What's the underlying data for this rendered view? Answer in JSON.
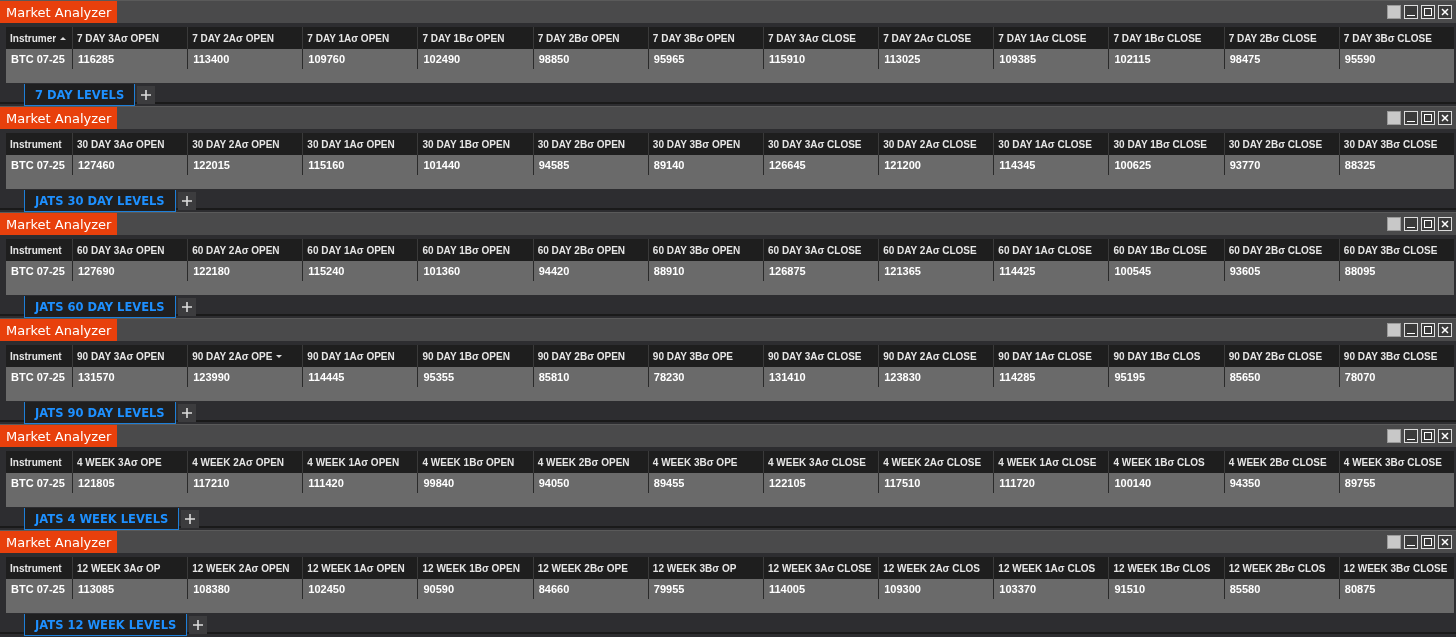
{
  "panels": [
    {
      "title": "Market Analyzer",
      "columns": [
        {
          "label": "Instrumer",
          "sort_ascending": true,
          "sort_descending": false
        },
        {
          "label": "7 DAY 3Aσ OPEN",
          "sort_ascending": false,
          "sort_descending": false
        },
        {
          "label": "7 DAY 2Aσ OPEN",
          "sort_ascending": false,
          "sort_descending": false
        },
        {
          "label": "7 DAY 1Aσ OPEN",
          "sort_ascending": false,
          "sort_descending": false
        },
        {
          "label": "7 DAY 1Bσ OPEN",
          "sort_ascending": false,
          "sort_descending": false
        },
        {
          "label": "7 DAY 2Bσ OPEN",
          "sort_ascending": false,
          "sort_descending": false
        },
        {
          "label": "7 DAY 3Bσ OPEN",
          "sort_ascending": false,
          "sort_descending": false
        },
        {
          "label": "7 DAY 3Aσ CLOSE",
          "sort_ascending": false,
          "sort_descending": false
        },
        {
          "label": "7 DAY 2Aσ CLOSE",
          "sort_ascending": false,
          "sort_descending": false
        },
        {
          "label": "7 DAY 1Aσ CLOSE",
          "sort_ascending": false,
          "sort_descending": false
        },
        {
          "label": "7 DAY 1Bσ CLOSE",
          "sort_ascending": false,
          "sort_descending": false
        },
        {
          "label": "7 DAY 2Bσ CLOSE",
          "sort_ascending": false,
          "sort_descending": false
        },
        {
          "label": "7 DAY 3Bσ CLOSE",
          "sort_ascending": false,
          "sort_descending": false
        }
      ],
      "rows": [
        {
          "cells": [
            "BTC 07-25",
            "116285",
            "113400",
            "109760",
            "102490",
            "98850",
            "95965",
            "115910",
            "113025",
            "109385",
            "102115",
            "98475",
            "95590"
          ]
        }
      ],
      "tabs": [
        {
          "label": "7 DAY LEVELS",
          "selected": true
        }
      ]
    },
    {
      "title": "Market Analyzer",
      "columns": [
        {
          "label": "Instrument",
          "sort_ascending": false,
          "sort_descending": false
        },
        {
          "label": "30 DAY 3Aσ OPEN",
          "sort_ascending": false,
          "sort_descending": false
        },
        {
          "label": "30 DAY 2Aσ OPEN",
          "sort_ascending": false,
          "sort_descending": false
        },
        {
          "label": "30 DAY 1Aσ OPEN",
          "sort_ascending": false,
          "sort_descending": false
        },
        {
          "label": "30 DAY 1Bσ OPEN",
          "sort_ascending": false,
          "sort_descending": false
        },
        {
          "label": "30 DAY 2Bσ OPEN",
          "sort_ascending": false,
          "sort_descending": false
        },
        {
          "label": "30 DAY 3Bσ OPEN",
          "sort_ascending": false,
          "sort_descending": false
        },
        {
          "label": "30 DAY 3Aσ CLOSE",
          "sort_ascending": false,
          "sort_descending": false
        },
        {
          "label": "30 DAY 2Aσ CLOSE",
          "sort_ascending": false,
          "sort_descending": false
        },
        {
          "label": "30 DAY 1Aσ CLOSE",
          "sort_ascending": false,
          "sort_descending": false
        },
        {
          "label": "30 DAY 1Bσ CLOSE",
          "sort_ascending": false,
          "sort_descending": false
        },
        {
          "label": "30 DAY 2Bσ CLOSE",
          "sort_ascending": false,
          "sort_descending": false
        },
        {
          "label": "30 DAY 3Bσ CLOSE",
          "sort_ascending": false,
          "sort_descending": false
        }
      ],
      "rows": [
        {
          "cells": [
            "BTC 07-25",
            "127460",
            "122015",
            "115160",
            "101440",
            "94585",
            "89140",
            "126645",
            "121200",
            "114345",
            "100625",
            "93770",
            "88325"
          ]
        }
      ],
      "tabs": [
        {
          "label": "JATS 30 DAY LEVELS",
          "selected": true
        }
      ]
    },
    {
      "title": "Market Analyzer",
      "columns": [
        {
          "label": "Instrument",
          "sort_ascending": false,
          "sort_descending": false
        },
        {
          "label": "60 DAY 3Aσ OPEN",
          "sort_ascending": false,
          "sort_descending": false
        },
        {
          "label": "60 DAY 2Aσ OPEN",
          "sort_ascending": false,
          "sort_descending": false
        },
        {
          "label": "60 DAY 1Aσ OPEN",
          "sort_ascending": false,
          "sort_descending": false
        },
        {
          "label": "60 DAY 1Bσ OPEN",
          "sort_ascending": false,
          "sort_descending": false
        },
        {
          "label": "60 DAY 2Bσ OPEN",
          "sort_ascending": false,
          "sort_descending": false
        },
        {
          "label": "60 DAY 3Bσ OPEN",
          "sort_ascending": false,
          "sort_descending": false
        },
        {
          "label": "60 DAY 3Aσ CLOSE",
          "sort_ascending": false,
          "sort_descending": false
        },
        {
          "label": "60 DAY 2Aσ CLOSE",
          "sort_ascending": false,
          "sort_descending": false
        },
        {
          "label": "60 DAY 1Aσ CLOSE",
          "sort_ascending": false,
          "sort_descending": false
        },
        {
          "label": "60 DAY 1Bσ CLOSE",
          "sort_ascending": false,
          "sort_descending": false
        },
        {
          "label": "60 DAY 2Bσ CLOSE",
          "sort_ascending": false,
          "sort_descending": false
        },
        {
          "label": "60 DAY 3Bσ CLOSE",
          "sort_ascending": false,
          "sort_descending": false
        }
      ],
      "rows": [
        {
          "cells": [
            "BTC 07-25",
            "127690",
            "122180",
            "115240",
            "101360",
            "94420",
            "88910",
            "126875",
            "121365",
            "114425",
            "100545",
            "93605",
            "88095"
          ]
        }
      ],
      "tabs": [
        {
          "label": "JATS 60 DAY LEVELS",
          "selected": true
        }
      ]
    },
    {
      "title": "Market Analyzer",
      "columns": [
        {
          "label": "Instrument",
          "sort_ascending": false,
          "sort_descending": false
        },
        {
          "label": "90 DAY 3Aσ OPEN",
          "sort_ascending": false,
          "sort_descending": false
        },
        {
          "label": "90 DAY 2Aσ OPE",
          "sort_ascending": false,
          "sort_descending": true
        },
        {
          "label": "90 DAY 1Aσ OPEN",
          "sort_ascending": false,
          "sort_descending": false
        },
        {
          "label": "90 DAY 1Bσ OPEN",
          "sort_ascending": false,
          "sort_descending": false
        },
        {
          "label": "90 DAY 2Bσ OPEN",
          "sort_ascending": false,
          "sort_descending": false
        },
        {
          "label": "90 DAY 3Bσ OPE",
          "sort_ascending": false,
          "sort_descending": false
        },
        {
          "label": "90 DAY 3Aσ CLOSE",
          "sort_ascending": false,
          "sort_descending": false
        },
        {
          "label": "90 DAY 2Aσ CLOSE",
          "sort_ascending": false,
          "sort_descending": false
        },
        {
          "label": "90 DAY 1Aσ CLOSE",
          "sort_ascending": false,
          "sort_descending": false
        },
        {
          "label": "90 DAY 1Bσ CLOS",
          "sort_ascending": false,
          "sort_descending": false
        },
        {
          "label": "90 DAY 2Bσ CLOSE",
          "sort_ascending": false,
          "sort_descending": false
        },
        {
          "label": "90 DAY 3Bσ CLOSE",
          "sort_ascending": false,
          "sort_descending": false
        }
      ],
      "rows": [
        {
          "cells": [
            "BTC 07-25",
            "131570",
            "123990",
            "114445",
            "95355",
            "85810",
            "78230",
            "131410",
            "123830",
            "114285",
            "95195",
            "85650",
            "78070"
          ]
        }
      ],
      "tabs": [
        {
          "label": "JATS 90 DAY LEVELS",
          "selected": true
        }
      ]
    },
    {
      "title": "Market Analyzer",
      "columns": [
        {
          "label": "Instrument",
          "sort_ascending": false,
          "sort_descending": false
        },
        {
          "label": "4 WEEK 3Aσ OPE",
          "sort_ascending": false,
          "sort_descending": false
        },
        {
          "label": "4 WEEK 2Aσ OPEN",
          "sort_ascending": false,
          "sort_descending": false
        },
        {
          "label": "4 WEEK 1Aσ OPEN",
          "sort_ascending": false,
          "sort_descending": false
        },
        {
          "label": "4 WEEK 1Bσ OPEN",
          "sort_ascending": false,
          "sort_descending": false
        },
        {
          "label": "4 WEEK 2Bσ OPEN",
          "sort_ascending": false,
          "sort_descending": false
        },
        {
          "label": "4 WEEK 3Bσ OPE",
          "sort_ascending": false,
          "sort_descending": false
        },
        {
          "label": "4 WEEK 3Aσ CLOSE",
          "sort_ascending": false,
          "sort_descending": false
        },
        {
          "label": "4 WEEK 2Aσ CLOSE",
          "sort_ascending": false,
          "sort_descending": false
        },
        {
          "label": "4 WEEK 1Aσ CLOSE",
          "sort_ascending": false,
          "sort_descending": false
        },
        {
          "label": "4 WEEK 1Bσ CLOS",
          "sort_ascending": false,
          "sort_descending": false
        },
        {
          "label": "4 WEEK 2Bσ CLOSE",
          "sort_ascending": false,
          "sort_descending": false
        },
        {
          "label": "4 WEEK 3Bσ CLOSE",
          "sort_ascending": false,
          "sort_descending": false
        }
      ],
      "rows": [
        {
          "cells": [
            "BTC 07-25",
            "121805",
            "117210",
            "111420",
            "99840",
            "94050",
            "89455",
            "122105",
            "117510",
            "111720",
            "100140",
            "94350",
            "89755"
          ]
        }
      ],
      "tabs": [
        {
          "label": "JATS 4 WEEK LEVELS",
          "selected": true
        }
      ]
    },
    {
      "title": "Market Analyzer",
      "columns": [
        {
          "label": "Instrument",
          "sort_ascending": false,
          "sort_descending": false
        },
        {
          "label": "12 WEEK 3Aσ OP",
          "sort_ascending": false,
          "sort_descending": false
        },
        {
          "label": "12 WEEK 2Aσ OPEN",
          "sort_ascending": false,
          "sort_descending": false
        },
        {
          "label": "12 WEEK 1Aσ OPEN",
          "sort_ascending": false,
          "sort_descending": false
        },
        {
          "label": "12 WEEK 1Bσ OPEN",
          "sort_ascending": false,
          "sort_descending": false
        },
        {
          "label": "12 WEEK 2Bσ OPE",
          "sort_ascending": false,
          "sort_descending": false
        },
        {
          "label": "12 WEEK 3Bσ OP",
          "sort_ascending": false,
          "sort_descending": false
        },
        {
          "label": "12 WEEK 3Aσ CLOSE",
          "sort_ascending": false,
          "sort_descending": false
        },
        {
          "label": "12 WEEK 2Aσ CLOS",
          "sort_ascending": false,
          "sort_descending": false
        },
        {
          "label": "12 WEEK 1Aσ CLOS",
          "sort_ascending": false,
          "sort_descending": false
        },
        {
          "label": "12 WEEK 1Bσ CLOS",
          "sort_ascending": false,
          "sort_descending": false
        },
        {
          "label": "12 WEEK 2Bσ CLOS",
          "sort_ascending": false,
          "sort_descending": false
        },
        {
          "label": "12 WEEK 3Bσ CLOSE",
          "sort_ascending": false,
          "sort_descending": false
        }
      ],
      "rows": [
        {
          "cells": [
            "BTC 07-25",
            "113085",
            "108380",
            "102450",
            "90590",
            "84660",
            "79955",
            "114005",
            "109300",
            "103370",
            "91510",
            "85580",
            "80875"
          ]
        }
      ],
      "tabs": [
        {
          "label": "JATS 12 WEEK LEVELS",
          "selected": true
        }
      ]
    }
  ]
}
